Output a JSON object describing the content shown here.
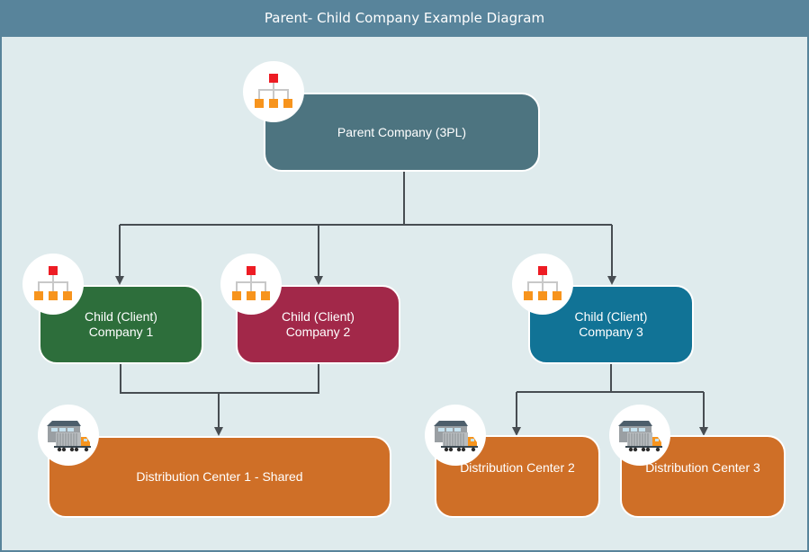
{
  "header": {
    "title": "Parent- Child Company Example Diagram"
  },
  "colors": {
    "header": "#58849b",
    "canvas": "#dfebed",
    "connector": "#474d52",
    "parent": "#4d7480",
    "child1": "#2d6e3b",
    "child2": "#a22849",
    "child3": "#117396",
    "distribution": "#cf6f27",
    "icon_red": "#ed1c24",
    "icon_orange": "#f7941d",
    "icon_gray": "#c8c8c8"
  },
  "nodes": {
    "parent": {
      "label": "Parent Company (3PL)",
      "icon": "org-chart-icon"
    },
    "child1": {
      "label_line1": "Child (Client)",
      "label_line2": "Company 1",
      "icon": "org-chart-icon"
    },
    "child2": {
      "label_line1": "Child (Client)",
      "label_line2": "Company 2",
      "icon": "org-chart-icon"
    },
    "child3": {
      "label_line1": "Child (Client)",
      "label_line2": "Company 3",
      "icon": "org-chart-icon"
    },
    "dc1": {
      "label": "Distribution Center 1 - Shared",
      "icon": "warehouse-truck-icon"
    },
    "dc2": {
      "label": "Distribution Center 2",
      "icon": "warehouse-truck-icon"
    },
    "dc3": {
      "label": "Distribution Center 3",
      "icon": "warehouse-truck-icon"
    }
  },
  "edges": [
    {
      "from": "parent",
      "to": "child1"
    },
    {
      "from": "parent",
      "to": "child2"
    },
    {
      "from": "parent",
      "to": "child3"
    },
    {
      "from": "child1",
      "to": "dc1"
    },
    {
      "from": "child2",
      "to": "dc1"
    },
    {
      "from": "child3",
      "to": "dc2"
    },
    {
      "from": "child3",
      "to": "dc3"
    }
  ]
}
